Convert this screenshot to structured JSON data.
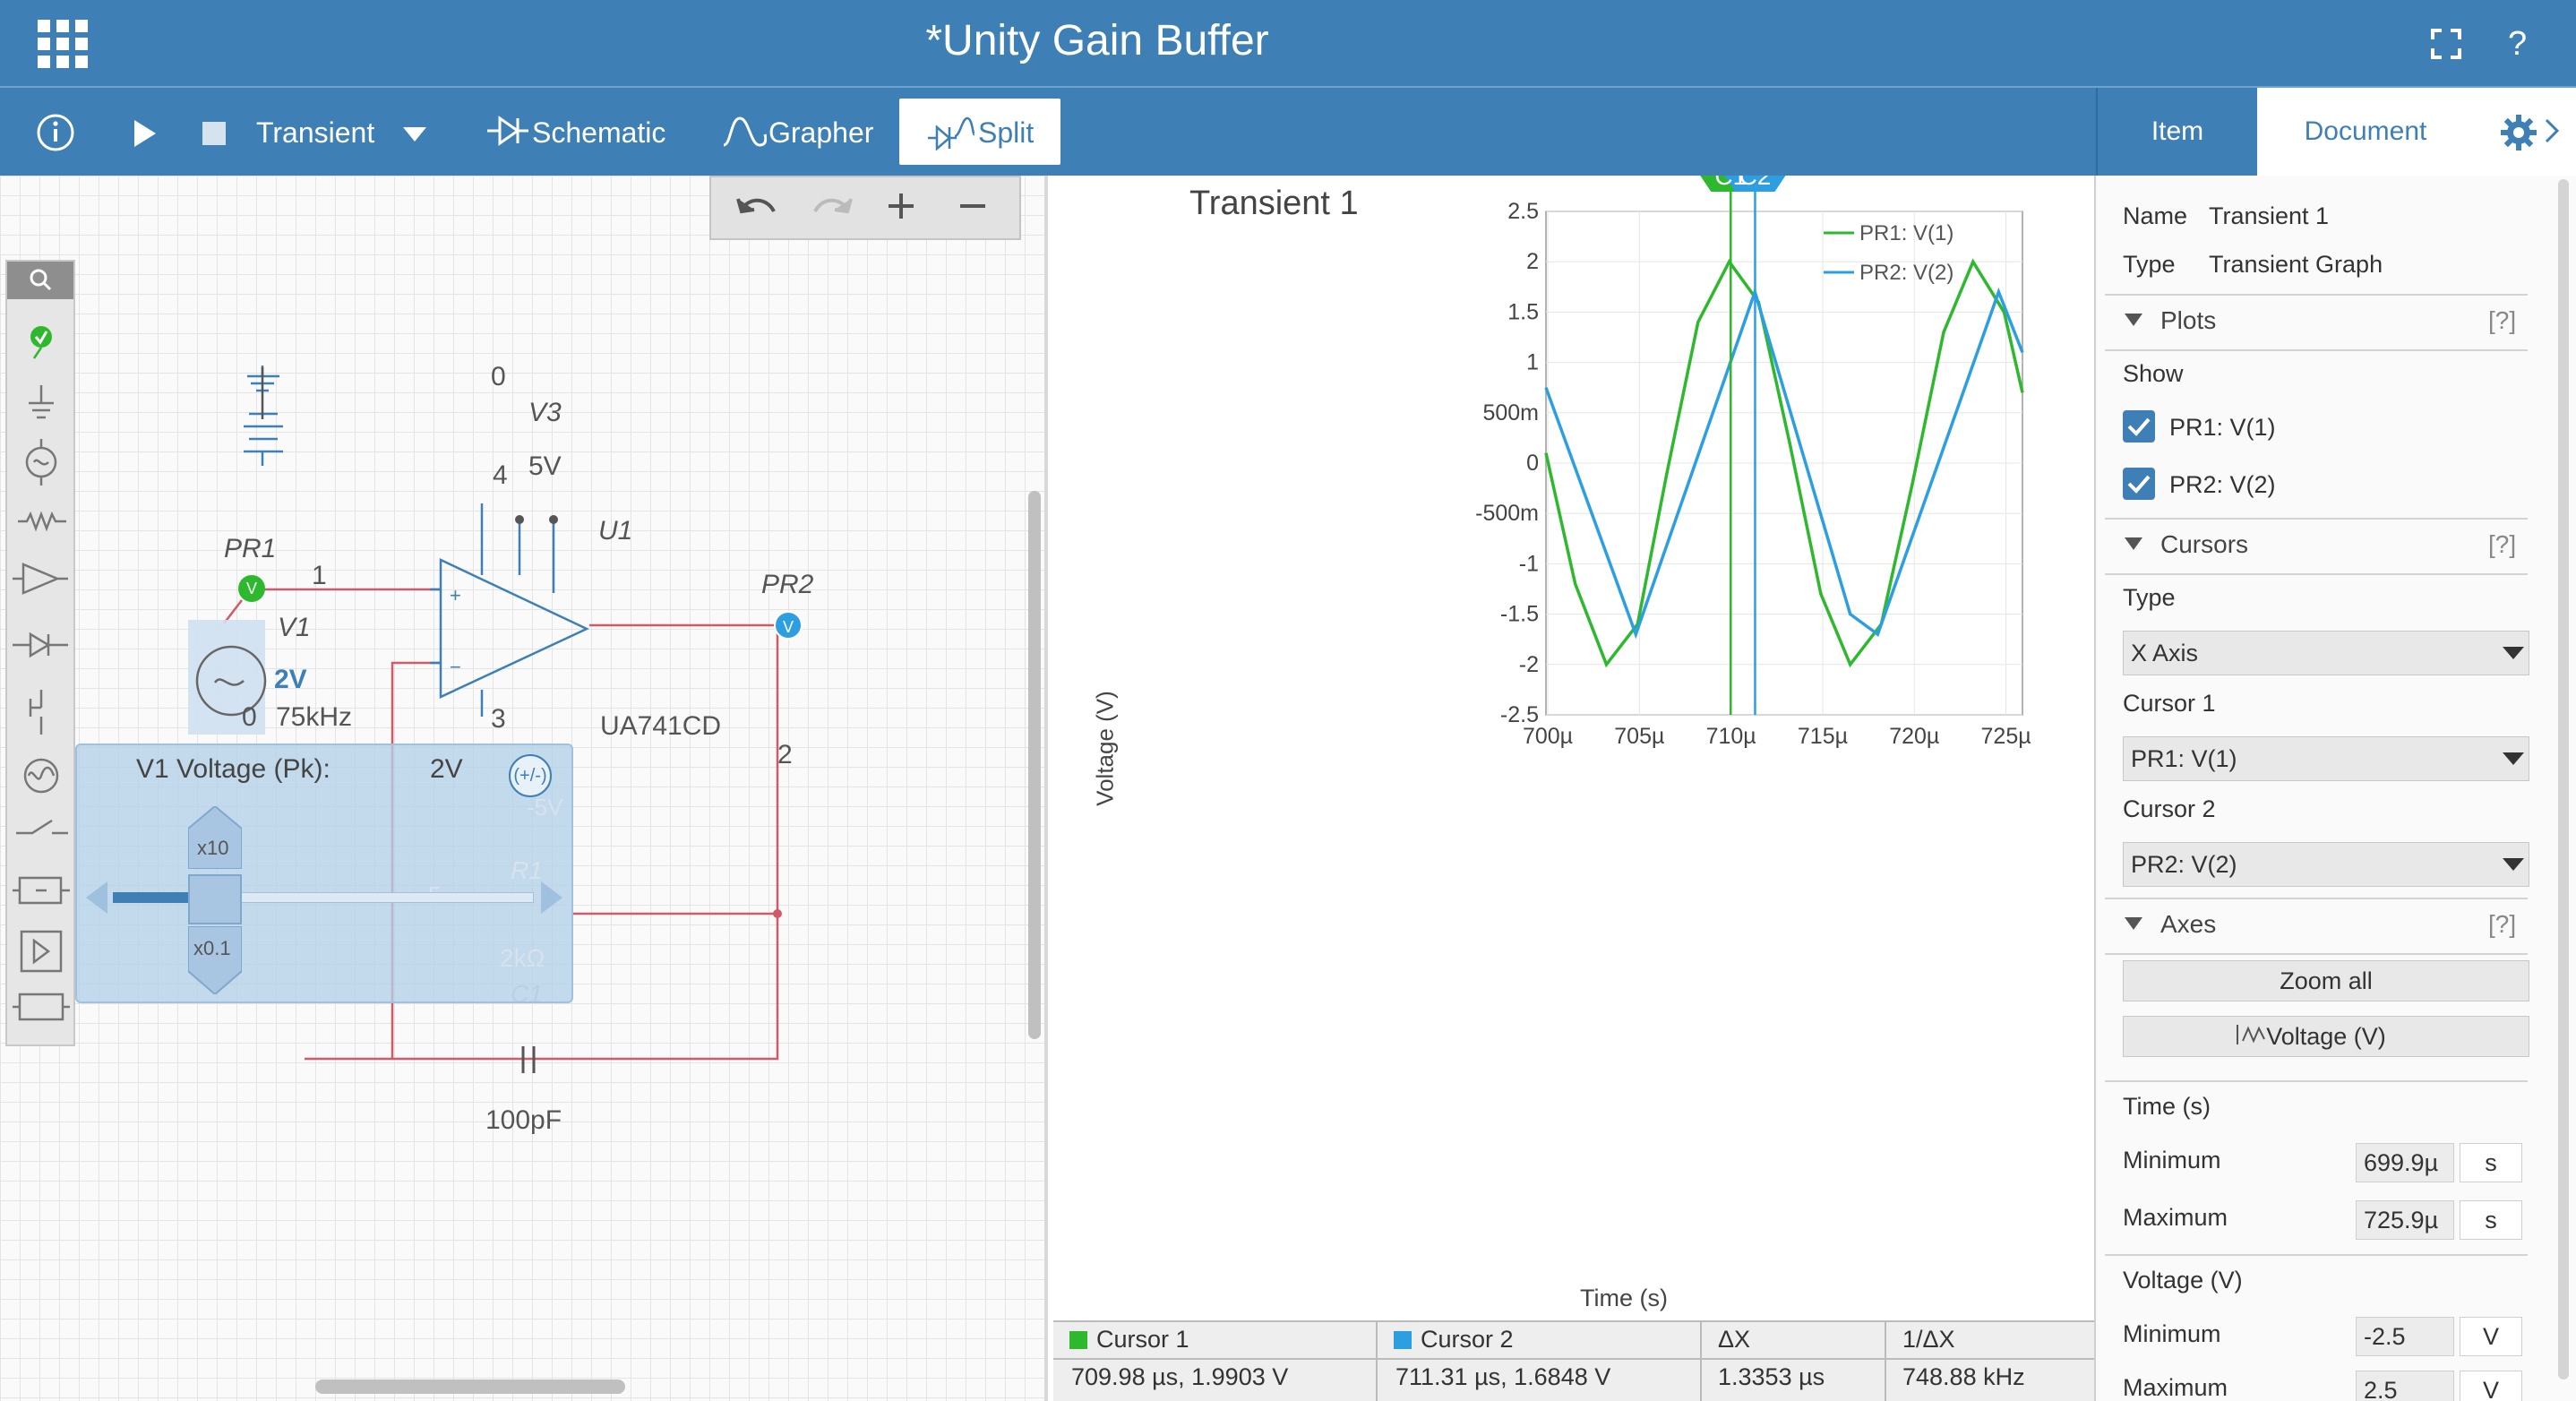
{
  "app": {
    "title": "*Unity Gain Buffer",
    "apps_icon": "grid-icon",
    "fullscreen_icon": "fullscreen-icon",
    "help_label": "?"
  },
  "toolbar": {
    "mode": "Transient",
    "schematic": "Schematic",
    "grapher": "Grapher",
    "split": "Split"
  },
  "right_tabs": {
    "item": "Item",
    "document": "Document"
  },
  "colors": {
    "brand": "#3e7fb5",
    "series1": "#2eb82e",
    "series2": "#2d9ee0",
    "wire": "#d05a6a",
    "component": "#3e7fb5"
  },
  "schematic": {
    "pr1": "PR1",
    "pr2": "PR2",
    "v1": "V1",
    "v1_amp": "2V",
    "v1_freq": "75kHz",
    "v3": "V3",
    "v3_val": "5V",
    "u1": "U1",
    "u1_part": "UA741CD",
    "node_1": "1",
    "node_2": "2",
    "node_3": "3",
    "node_4": "4",
    "node_0a": "0",
    "node_0b": "0",
    "c1": "C1",
    "c1_val": "100pF",
    "r1": "R1",
    "r1_val": "2kΩ",
    "v2_val": "-5V",
    "node_5": "5"
  },
  "popup": {
    "label": "V1 Voltage (Pk):",
    "value": "2V",
    "sign_button": "(+/-)",
    "mult_up": "x10",
    "mult_down": "x0.1",
    "slider_fraction": 0.24
  },
  "graph": {
    "title": "Transient 1",
    "cursor1": "C1",
    "cursor2": "C2",
    "legend": [
      "PR1: V(1)",
      "PR2: V(2)"
    ]
  },
  "chart_data": {
    "type": "line",
    "title": "Transient 1",
    "xlabel": "Time (s)",
    "ylabel": "Voltage (V)",
    "xlim": [
      699.9,
      725.9
    ],
    "ylim": [
      -2.5,
      2.5
    ],
    "x_ticks": [
      "700µ",
      "705µ",
      "710µ",
      "715µ",
      "720µ",
      "725µ"
    ],
    "y_ticks": [
      "2.5",
      "2",
      "1.5",
      "1",
      "500m",
      "0",
      "-500m",
      "-1",
      "-1.5",
      "-2",
      "-2.5"
    ],
    "legend_position": "top-right",
    "grid": true,
    "series": [
      {
        "name": "PR1: V(1)",
        "color": "#2eb82e",
        "x": [
          699.9,
          701.5,
          703.2,
          704.9,
          706.5,
          708.2,
          709.9,
          711.5,
          713.2,
          714.9,
          716.5,
          718.2,
          719.9,
          721.6,
          723.2,
          724.9,
          725.9
        ],
        "y": [
          0.1,
          -1.2,
          -2.0,
          -1.6,
          -0.1,
          1.4,
          2.0,
          1.6,
          0.2,
          -1.3,
          -2.0,
          -1.6,
          -0.2,
          1.3,
          2.0,
          1.5,
          0.7
        ]
      },
      {
        "name": "PR2: V(2)",
        "color": "#2d9ee0",
        "x": [
          699.9,
          704.8,
          711.3,
          716.5,
          718.0,
          724.6,
          725.9
        ],
        "y": [
          0.75,
          -1.7,
          1.7,
          -1.5,
          -1.7,
          1.7,
          1.1
        ]
      }
    ],
    "cursors": [
      {
        "name": "C1",
        "x": 709.98
      },
      {
        "name": "C2",
        "x": 711.31
      }
    ]
  },
  "cursor_table": {
    "headers": [
      "Cursor 1",
      "Cursor 2",
      "ΔX",
      "1/ΔX"
    ],
    "values": [
      "709.98 µs, 1.9903 V",
      "711.31 µs, 1.6848 V",
      "1.3353 µs",
      "748.88 kHz"
    ]
  },
  "panel": {
    "name_label": "Name",
    "name_value": "Transient 1",
    "type_label": "Type",
    "type_value": "Transient Graph",
    "plots": "Plots",
    "help": "[?]",
    "show": "Show",
    "plot1": "PR1: V(1)",
    "plot2": "PR2: V(2)",
    "cursors": "Cursors",
    "cursor_type_label": "Type",
    "cursor_type": "X Axis",
    "cursor1_label": "Cursor 1",
    "cursor1_value": "PR1: V(1)",
    "cursor2_label": "Cursor 2",
    "cursor2_value": "PR2: V(2)",
    "axes": "Axes",
    "zoom_all": "Zoom all",
    "voltage_btn": "Voltage (V)",
    "time_label": "Time (s)",
    "min_label": "Minimum",
    "max_label": "Maximum",
    "time_min": "699.9µ",
    "time_max": "725.9µ",
    "time_unit": "s",
    "volt_label": "Voltage (V)",
    "volt_min": "-2.5",
    "volt_max": "2.5",
    "volt_unit": "V"
  }
}
